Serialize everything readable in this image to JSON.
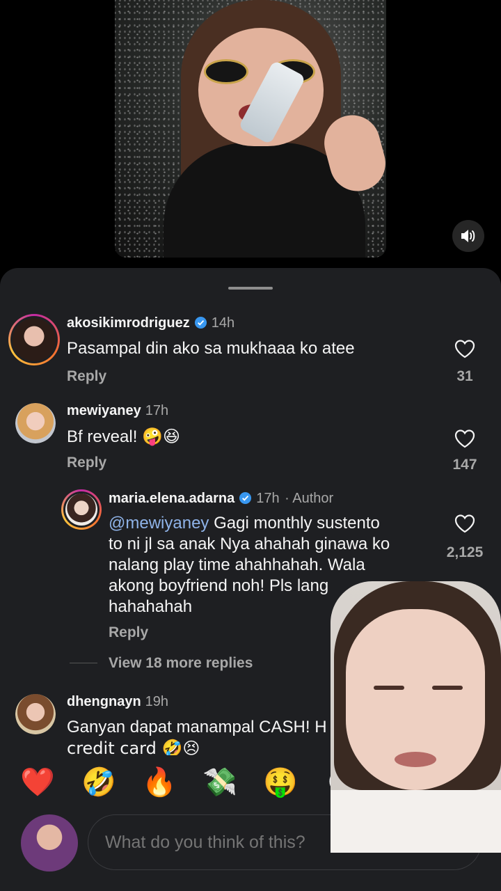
{
  "comments": [
    {
      "username": "akosikimrodriguez",
      "verified": true,
      "time": "14h",
      "text": "Pasampal din ako sa mukhaaa ko atee",
      "reply_label": "Reply",
      "likes": "31"
    },
    {
      "username": "mewiyaney",
      "verified": false,
      "time": "17h",
      "text": "Bf reveal!",
      "emojis": "🤪😆",
      "reply_label": "Reply",
      "likes": "147"
    }
  ],
  "reply": {
    "username": "maria.elena.adarna",
    "verified": true,
    "time": "17h",
    "author_tag": "· Author",
    "mention": "@mewiyaney",
    "text_line1": " Gagi monthly sustento",
    "text_line2": "to ni jl sa anak Nya ahahah ginawa ko",
    "text_line3": "nalang play time ahahhahah. Wala",
    "text_line4": "akong boyfriend noh! Pls lang",
    "text_line5": "hahahahah",
    "reply_label": "Reply",
    "likes": "2,125"
  },
  "view_more": "View 18 more replies",
  "third_comment": {
    "username": "dhengnayn",
    "time": "19h",
    "text": "Ganyan dapat manampal CASH! H",
    "text_line2": "credit card 🤣😣"
  },
  "emoji_bar": [
    "❤️",
    "🤣",
    "🔥",
    "💸",
    "🤑",
    "😍"
  ],
  "input": {
    "placeholder": "What do you think of this?"
  },
  "icons": {
    "sound": "speaker-icon",
    "like": "heart-outline-icon",
    "verified": "verified-badge-icon"
  },
  "colors": {
    "sheet_bg": "#1e1f22",
    "mention": "#8fb3e8",
    "verified": "#3897f0"
  }
}
